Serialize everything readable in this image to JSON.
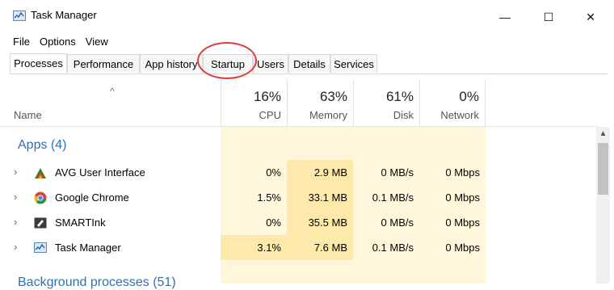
{
  "window": {
    "title": "Task Manager",
    "minimize_glyph": "—",
    "maximize_glyph": "☐",
    "close_glyph": "✕"
  },
  "menu": [
    "File",
    "Options",
    "View"
  ],
  "tabs": [
    {
      "label": "Processes",
      "active": true
    },
    {
      "label": "Performance"
    },
    {
      "label": "App history"
    },
    {
      "label": "Startup",
      "highlighted": true
    },
    {
      "label": "Users"
    },
    {
      "label": "Details"
    },
    {
      "label": "Services"
    }
  ],
  "header": {
    "sort_caret": "^",
    "name_label": "Name",
    "columns": [
      {
        "pct": "16%",
        "label": "CPU"
      },
      {
        "pct": "63%",
        "label": "Memory"
      },
      {
        "pct": "61%",
        "label": "Disk"
      },
      {
        "pct": "0%",
        "label": "Network"
      }
    ]
  },
  "apps_group": {
    "title": "Apps (4)",
    "rows": [
      {
        "name": "AVG User Interface",
        "icon": "avg-icon",
        "cpu": "0%",
        "memory": "2.9 MB",
        "disk": "0 MB/s",
        "network": "0 Mbps"
      },
      {
        "name": "Google Chrome",
        "icon": "chrome-icon",
        "cpu": "1.5%",
        "memory": "33.1 MB",
        "disk": "0.1 MB/s",
        "network": "0 Mbps"
      },
      {
        "name": "SMARTInk",
        "icon": "smartink-icon",
        "cpu": "0%",
        "memory": "35.5 MB",
        "disk": "0 MB/s",
        "network": "0 Mbps"
      },
      {
        "name": "Task Manager",
        "icon": "task-manager-icon",
        "cpu": "3.1%",
        "memory": "7.6 MB",
        "disk": "0.1 MB/s",
        "network": "0 Mbps"
      }
    ]
  },
  "background_group": {
    "title": "Background processes (51)"
  },
  "colors": {
    "accent": "#2f6fb5",
    "highlight_circle": "#e23b3b",
    "usage_light": "#fff6dc",
    "usage_medium": "#fde9a9"
  }
}
